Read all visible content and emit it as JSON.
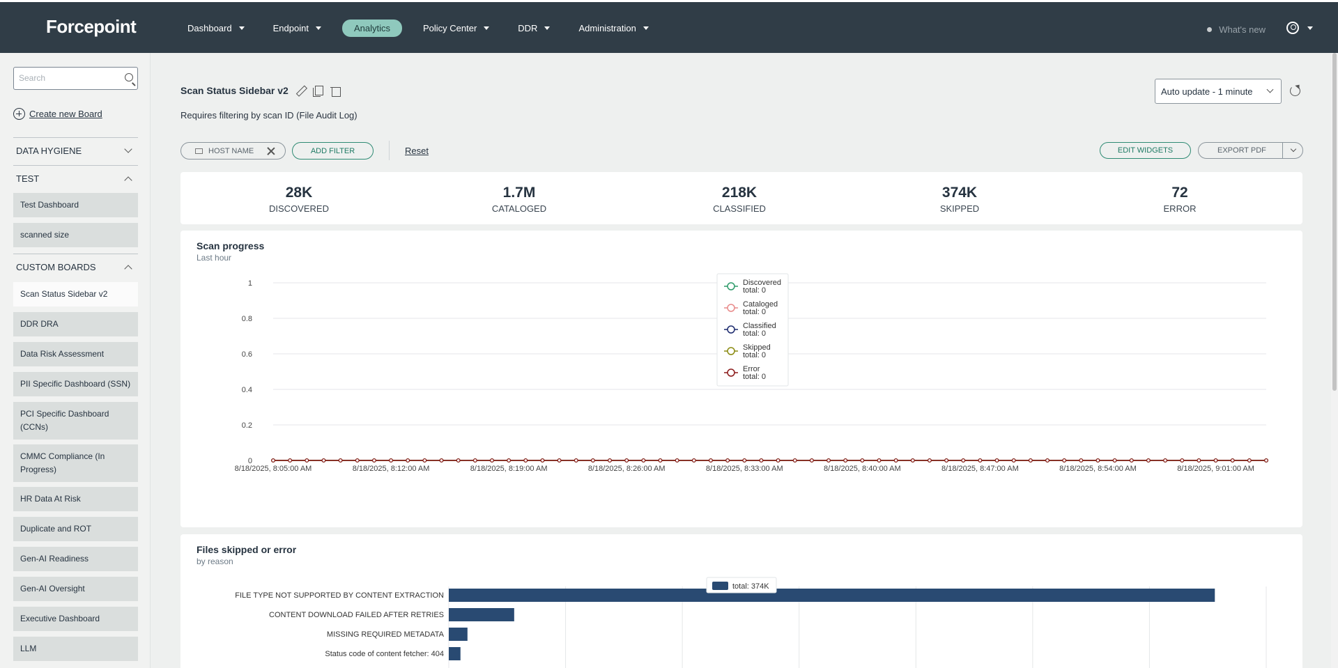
{
  "app": {
    "logo": "Forcepoint"
  },
  "nav": {
    "items": [
      {
        "label": "Dashboard",
        "caret": true
      },
      {
        "label": "Endpoint",
        "caret": true
      },
      {
        "label": "Analytics",
        "caret": false,
        "active": true
      },
      {
        "label": "Policy Center",
        "caret": true
      },
      {
        "label": "DDR",
        "caret": true
      },
      {
        "label": "Administration",
        "caret": true
      }
    ],
    "whats_new": "What's new"
  },
  "sidebar": {
    "search_placeholder": "Search",
    "create_board": "Create new Board",
    "sections": {
      "data_hygiene": "DATA HYGIENE",
      "test": "TEST",
      "custom_boards": "CUSTOM BOARDS"
    },
    "test_items": [
      "Test Dashboard",
      "scanned size"
    ],
    "custom_items": [
      "Scan Status Sidebar v2",
      "DDR DRA",
      "Data Risk Assessment",
      "PII Specific Dashboard (SSN)",
      "PCI Specific Dashboard (CCNs)",
      "CMMC Compliance (In Progress)",
      "HR Data At Risk",
      "Duplicate and ROT",
      "Gen-AI Readiness",
      "Gen-AI Oversight",
      "Executive Dashboard",
      "LLM"
    ]
  },
  "board": {
    "title": "Scan Status Sidebar v2",
    "subtitle": "Requires filtering by scan ID (File Audit Log)",
    "auto_update": "Auto update - 1 minute",
    "filter_chip": "HOST NAME",
    "add_filter": "ADD FILTER",
    "reset": "Reset",
    "edit_widgets": "EDIT WIDGETS",
    "export_pdf": "EXPORT PDF"
  },
  "stats": [
    {
      "value": "28K",
      "label": "DISCOVERED"
    },
    {
      "value": "1.7M",
      "label": "CATALOGED"
    },
    {
      "value": "218K",
      "label": "CLASSIFIED"
    },
    {
      "value": "374K",
      "label": "SKIPPED"
    },
    {
      "value": "72",
      "label": "ERROR"
    }
  ],
  "scan_progress": {
    "title": "Scan progress",
    "subtitle": "Last hour"
  },
  "files_skipped": {
    "title": "Files skipped or error",
    "subtitle": "by reason"
  },
  "chart_data": [
    {
      "type": "line",
      "title": "Scan progress",
      "subtitle": "Last hour",
      "ylim": [
        0,
        1
      ],
      "yticks": [
        "0",
        "0.2",
        "0.4",
        "0.6",
        "0.8",
        "1"
      ],
      "xtick_labels": [
        "8/18/2025, 8:05:00 AM",
        "8/18/2025, 8:12:00 AM",
        "8/18/2025, 8:19:00 AM",
        "8/18/2025, 8:26:00 AM",
        "8/18/2025, 8:33:00 AM",
        "8/18/2025, 8:40:00 AM",
        "8/18/2025, 8:47:00 AM",
        "8/18/2025, 8:54:00 AM",
        "8/18/2025, 9:01:00 AM"
      ],
      "x_start_minute": "8:05",
      "point_count": 60,
      "grid": true,
      "legend_position": "top-center",
      "series": [
        {
          "name": "Discovered",
          "total": "total: 0",
          "color": "#2e9b6a",
          "value": 0
        },
        {
          "name": "Cataloged",
          "total": "total: 0",
          "color": "#e88a8a",
          "value": 0
        },
        {
          "name": "Classified",
          "total": "total: 0",
          "color": "#1c2a6e",
          "value": 0
        },
        {
          "name": "Skipped",
          "total": "total: 0",
          "color": "#8a8a10",
          "value": 0
        },
        {
          "name": "Error",
          "total": "total: 0",
          "color": "#8b1a1a",
          "value": 0
        }
      ]
    },
    {
      "type": "bar",
      "orientation": "horizontal",
      "title": "Files skipped or error",
      "subtitle": "by reason",
      "legend": "total: 374K",
      "color": "#294a72",
      "categories": [
        "FILE TYPE NOT SUPPORTED BY CONTENT EXTRACTION",
        "CONTENT DOWNLOAD FAILED AFTER RETRIES",
        "MISSING REQUIRED METADATA",
        "Status code of content fetcher: 404"
      ],
      "values": [
        328000,
        28000,
        8000,
        5000
      ],
      "xlim": [
        0,
        350000
      ]
    }
  ]
}
